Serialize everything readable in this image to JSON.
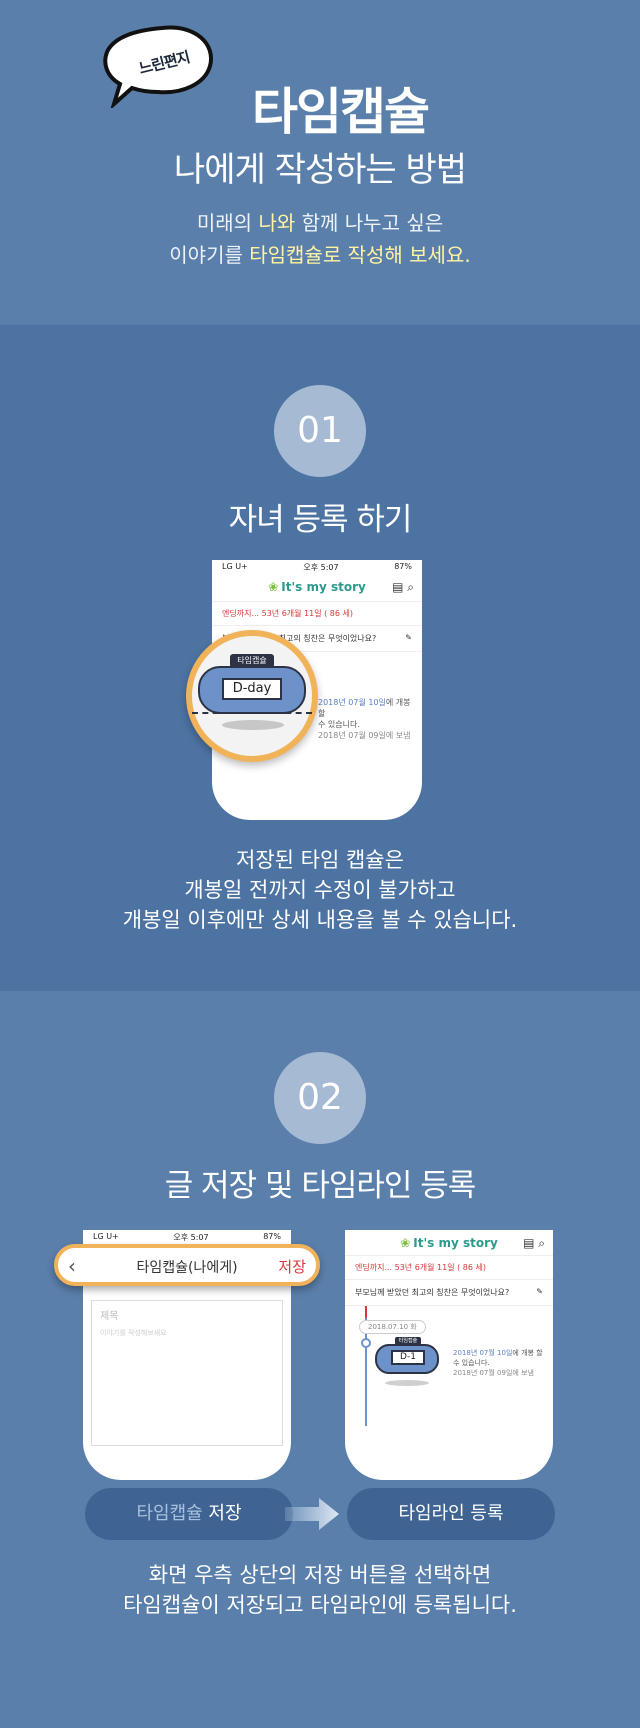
{
  "header": {
    "bubble_text": "느린편지",
    "title": "타임캡슐",
    "subtitle": "나에게 작성하는 방법",
    "desc_line1_a": "미래의 ",
    "desc_line1_hl": "나와",
    "desc_line1_b": " 함께 나누고 싶은",
    "desc_line2_a": "이야기를 ",
    "desc_line2_hl": "타임캡슐로 작성해 보세요."
  },
  "step1": {
    "number": "01",
    "title": "자녀 등록 하기",
    "phone": {
      "carrier": "LG U+",
      "time": "오후 5:07",
      "battery": "87%",
      "brand": "It's my story",
      "countdown": "엔딩까지... 53년 6개월 11일 ( 86 세)",
      "question": "부모님께 받았던 최고의 칭찬은 무엇이었나요?",
      "capsule_top": "타임캡슐",
      "capsule_label": "D-day",
      "note_date": "2018년 07월 10일",
      "note_text1": "에 개봉 할",
      "note_text2": "수 있습니다.",
      "note_sent": "2018년 07월 09일에 보냄"
    },
    "caption": [
      "저장된 타임 캡슐은",
      "개봉일 전까지 수정이 불가하고",
      "개봉일 이후에만 상세 내용을 볼 수 있습니다."
    ]
  },
  "step2": {
    "number": "02",
    "title": "글 저장 및 타임라인 등록",
    "left_phone": {
      "carrier": "LG U+",
      "time": "오후 5:07",
      "battery": "87%",
      "bar_title": "타임캡슐(나에게)",
      "bar_save": "저장",
      "field_title": "제목",
      "field_placeholder": "이야기를 작성해보세요"
    },
    "right_phone": {
      "brand": "It's my story",
      "countdown": "엔딩까지... 53년 6개월 11일 ( 86 세)",
      "question": "부모님께 받았던 최고의 칭찬은 무엇이었나요?",
      "timeline_date": "2018.07.10 화",
      "capsule_top": "타임캡슐",
      "capsule_label": "D-1",
      "note_date": "2018년 07월 10일",
      "note_text1": "에 개봉 할",
      "note_text2": "수 있습니다.",
      "note_sent": "2018년 07월 09일에 보냄"
    },
    "btn_save_a": "타임캡슐 ",
    "btn_save_b": "저장",
    "btn_register": "타임라인 등록",
    "caption": [
      "화면 우측 상단의 저장 버튼을 선택하면",
      "타임캡슐이 저장되고 타임라인에 등록됩니다."
    ]
  }
}
